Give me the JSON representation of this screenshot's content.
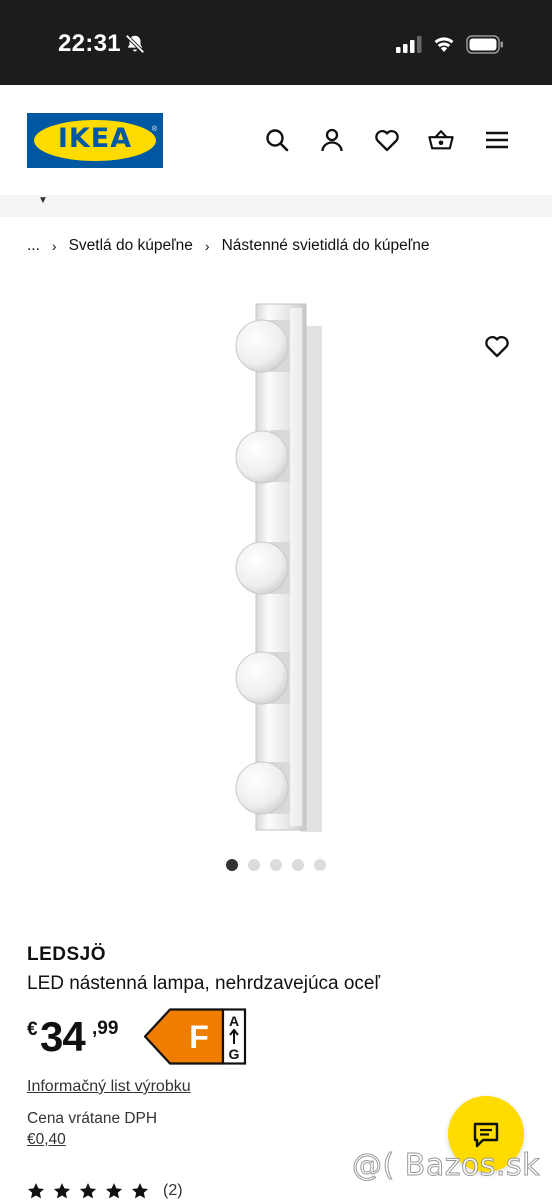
{
  "status_bar": {
    "time": "22:31",
    "icons": [
      "bell-muted-icon",
      "signal-icon",
      "wifi-icon",
      "battery-icon"
    ]
  },
  "header": {
    "logo_text": "IKEA",
    "icons": [
      "search-icon",
      "user-icon",
      "heart-icon",
      "basket-icon",
      "menu-icon"
    ]
  },
  "breadcrumb": {
    "items": [
      "...",
      "Svetlá do kúpeľne",
      "Nástenné svietidlá do kúpeľne"
    ],
    "separator": "›"
  },
  "gallery": {
    "image_count": 5,
    "active_index": 0
  },
  "product": {
    "name": "LEDSJÖ",
    "description": "LED nástenná lampa, nehrdzavejúca oceľ",
    "price": {
      "currency": "€",
      "integer": "34",
      "decimal": ",99"
    },
    "energy_class": {
      "grade": "F",
      "scale_top": "A",
      "scale_bottom": "G",
      "color": "#ef7d00"
    },
    "info_link": "Informačný list výrobku",
    "vat_label": "Cena vrátane DPH",
    "vat_value": "€0,40",
    "rating": {
      "stars": 5,
      "count": "(2)"
    }
  },
  "watermark": "@( Bazos.sk",
  "colors": {
    "ikea_blue": "#0058a3",
    "ikea_yellow": "#ffdb00",
    "status_bar": "#1c1c1c"
  }
}
